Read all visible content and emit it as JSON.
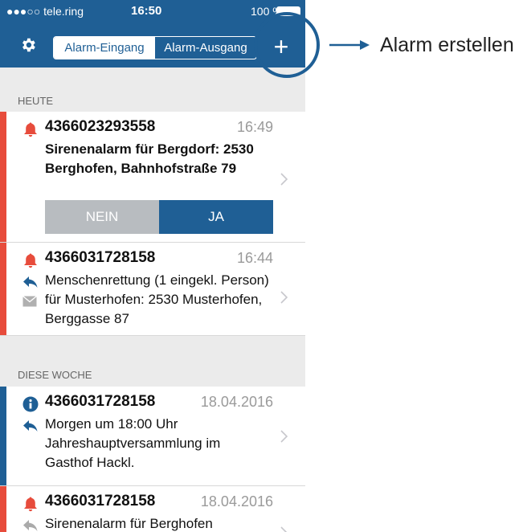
{
  "status_bar": {
    "carrier": "●●●○○ tele.ring",
    "time": "16:50",
    "battery": "100 %"
  },
  "header": {
    "tabs": [
      {
        "label": "Alarm-Eingang",
        "active": true
      },
      {
        "label": "Alarm-Ausgang",
        "active": false
      }
    ],
    "add_label": "+"
  },
  "sections": [
    {
      "title": "HEUTE",
      "items": [
        {
          "number": "4366023293558",
          "time": "16:49",
          "message": "Sirenenalarm für Bergdorf: 2530 Berghofen, Bahnhofstraße 79",
          "icons": [
            "bell-icon"
          ],
          "bar_color": "#e74c3c"
        },
        {
          "number": "4366031728158",
          "time": "16:44",
          "message": "Menschenrettung (1 eingekl. Person) für Musterhofen: 2530 Musterhofen, Berggasse 87",
          "icons": [
            "bell-icon",
            "reply-icon",
            "envelope-icon"
          ],
          "bar_color": "#e74c3c"
        }
      ]
    },
    {
      "title": "DIESE WOCHE",
      "items": [
        {
          "number": "4366031728158",
          "time": "18.04.2016",
          "message": "Morgen um 18:00 Uhr Jahreshauptversammlung im Gasthof Hackl.",
          "icons": [
            "info-icon",
            "reply-icon"
          ],
          "bar_color": "#1f5f95"
        },
        {
          "number": "4366031728158",
          "time": "18.04.2016",
          "message": "Sirenenalarm für Berghofen",
          "icons": [
            "bell-icon",
            "reply-icon"
          ],
          "bar_color": "#e74c3c"
        }
      ]
    }
  ],
  "answer_buttons": {
    "no": "NEIN",
    "yes": "JA"
  },
  "annotation": {
    "label": "Alarm erstellen"
  },
  "colors": {
    "header": "#1f5f95",
    "alarm": "#e74c3c",
    "info": "#1f5f95",
    "no_button": "#b8bcc0"
  }
}
